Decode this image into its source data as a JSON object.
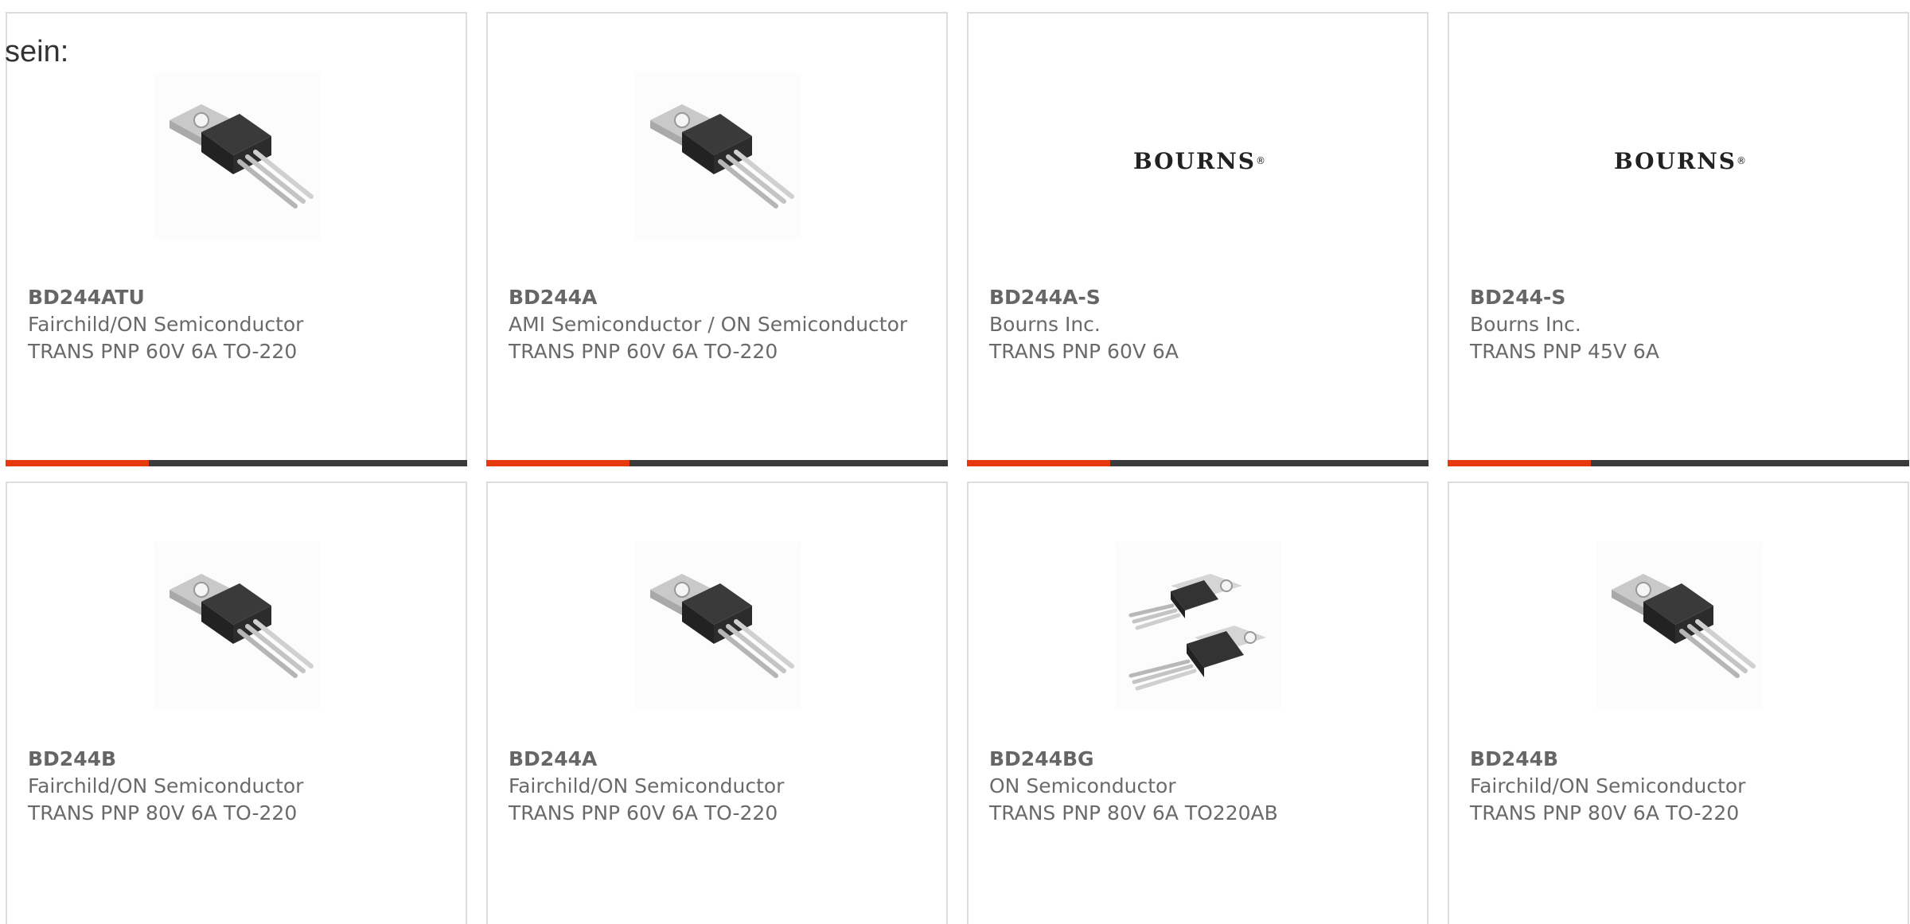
{
  "intro_text": "sein:",
  "accent_color": "#e8380d",
  "bar_color": "#3a3a3a",
  "products": [
    {
      "part": "BD244ATU",
      "manufacturer": "Fairchild/ON Semiconductor",
      "description": "TRANS PNP 60V 6A TO-220",
      "image": "to220-transistor",
      "progress": 0.31
    },
    {
      "part": "BD244A",
      "manufacturer": "AMI Semiconductor / ON Semiconductor",
      "description": "TRANS PNP 60V 6A TO-220",
      "image": "to220-transistor",
      "progress": 0.31
    },
    {
      "part": "BD244A-S",
      "manufacturer": "Bourns Inc.",
      "description": "TRANS PNP 60V 6A",
      "image": "bourns-logo",
      "logo_text": "BOURNS",
      "logo_mark": "®",
      "progress": 0.31
    },
    {
      "part": "BD244-S",
      "manufacturer": "Bourns Inc.",
      "description": "TRANS PNP 45V 6A",
      "image": "bourns-logo",
      "logo_text": "BOURNS",
      "logo_mark": "®",
      "progress": 0.31
    },
    {
      "part": "BD244B",
      "manufacturer": "Fairchild/ON Semiconductor",
      "description": "TRANS PNP 80V 6A TO-220",
      "image": "to220-transistor"
    },
    {
      "part": "BD244A",
      "manufacturer": "Fairchild/ON Semiconductor",
      "description": "TRANS PNP 60V 6A TO-220",
      "image": "to220-transistor"
    },
    {
      "part": "BD244BG",
      "manufacturer": "ON Semiconductor",
      "description": "TRANS PNP 80V 6A TO220AB",
      "image": "to220-transistor-pair"
    },
    {
      "part": "BD244B",
      "manufacturer": "Fairchild/ON Semiconductor",
      "description": "TRANS PNP 80V 6A TO-220",
      "image": "to220-transistor"
    }
  ]
}
